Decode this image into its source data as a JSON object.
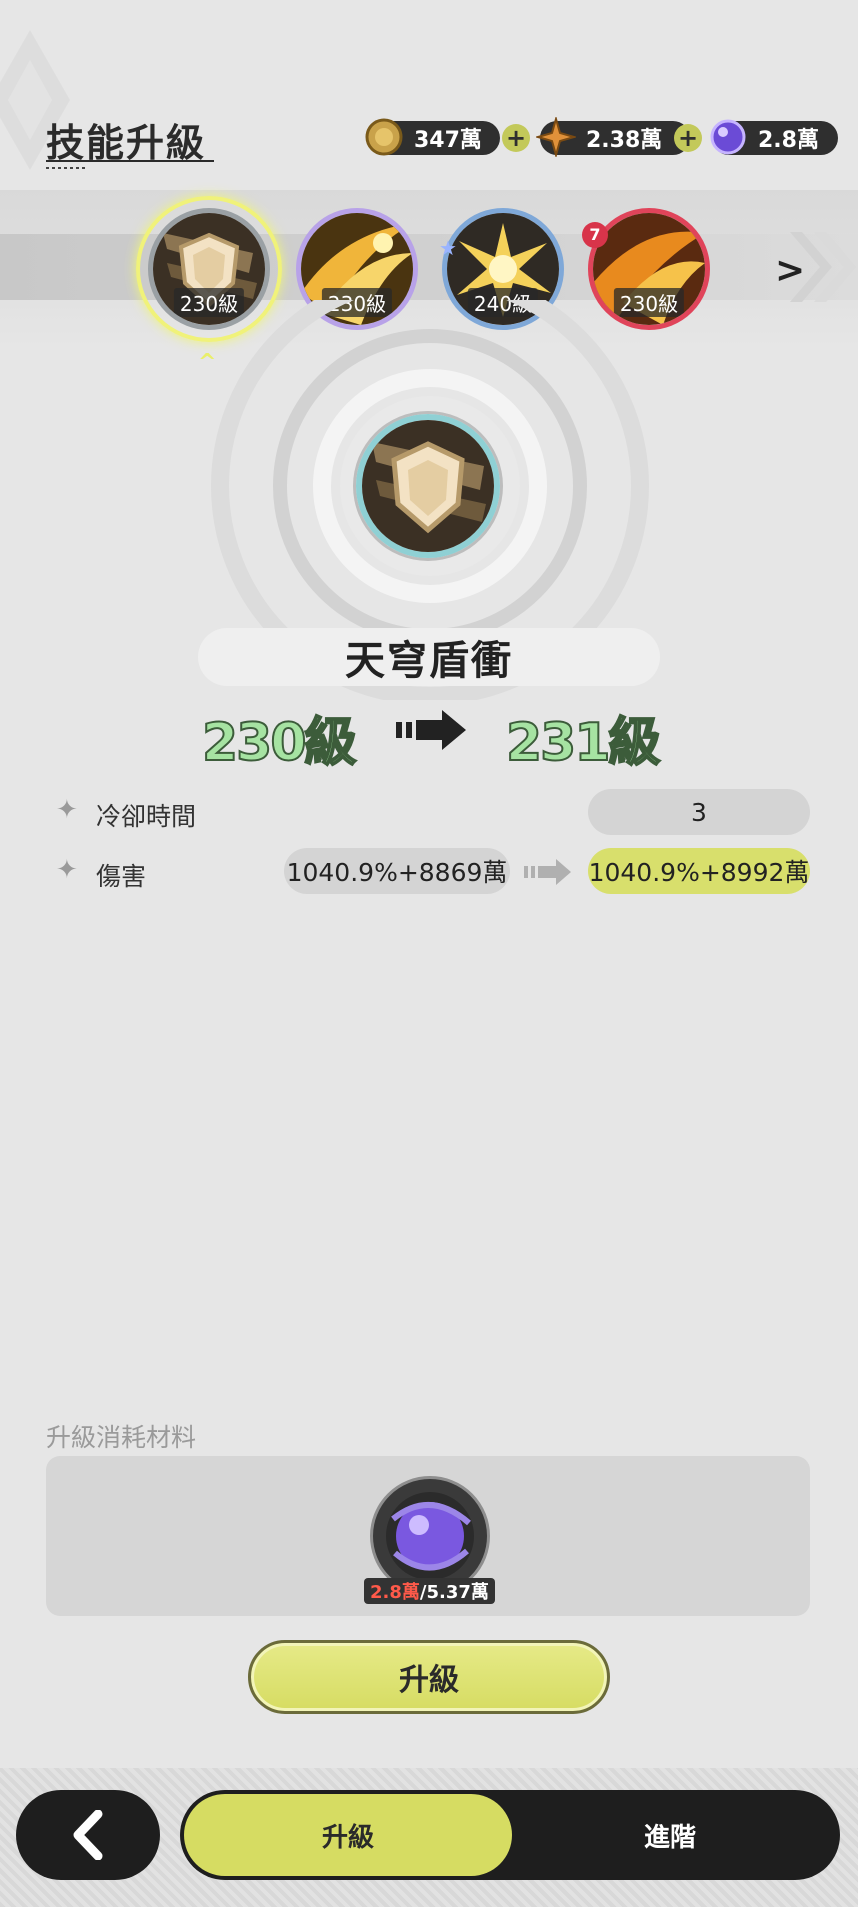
{
  "header": {
    "title": "技能升級",
    "currencies": [
      {
        "icon": "gold-coin-icon",
        "value": "347萬"
      },
      {
        "icon": "orange-crystal-icon",
        "value": "2.38萬"
      },
      {
        "icon": "purple-orb-icon",
        "value": "2.8萬"
      }
    ]
  },
  "skills": [
    {
      "icon": "shield-slash-skill-icon",
      "level": "230級",
      "selected": true
    },
    {
      "icon": "golden-claw-skill-icon",
      "level": "230級"
    },
    {
      "icon": "explosion-burst-skill-icon",
      "level": "240級"
    },
    {
      "icon": "flame-slash-skill-icon",
      "level": "230級",
      "badge": "7"
    }
  ],
  "skill_detail": {
    "name": "天穹盾衝",
    "level_from": "230級",
    "level_to": "231級",
    "stats": [
      {
        "label": "冷卻時間",
        "value": "3"
      },
      {
        "label": "傷害",
        "from": "1040.9%+8869萬",
        "to": "1040.9%+8992萬"
      }
    ]
  },
  "materials": {
    "title": "升級消耗材料",
    "item": {
      "icon": "purple-orb-icon",
      "have": "2.8萬",
      "need": "/5.37萬"
    }
  },
  "actions": {
    "upgrade_label": "升級"
  },
  "tabs": [
    {
      "label": "升級",
      "active": true
    },
    {
      "label": "進階",
      "active": false
    }
  ],
  "colors": {
    "accent": "#d6dc62",
    "level_text": "#a6e3a2",
    "shortage": "#ff5a4a"
  }
}
